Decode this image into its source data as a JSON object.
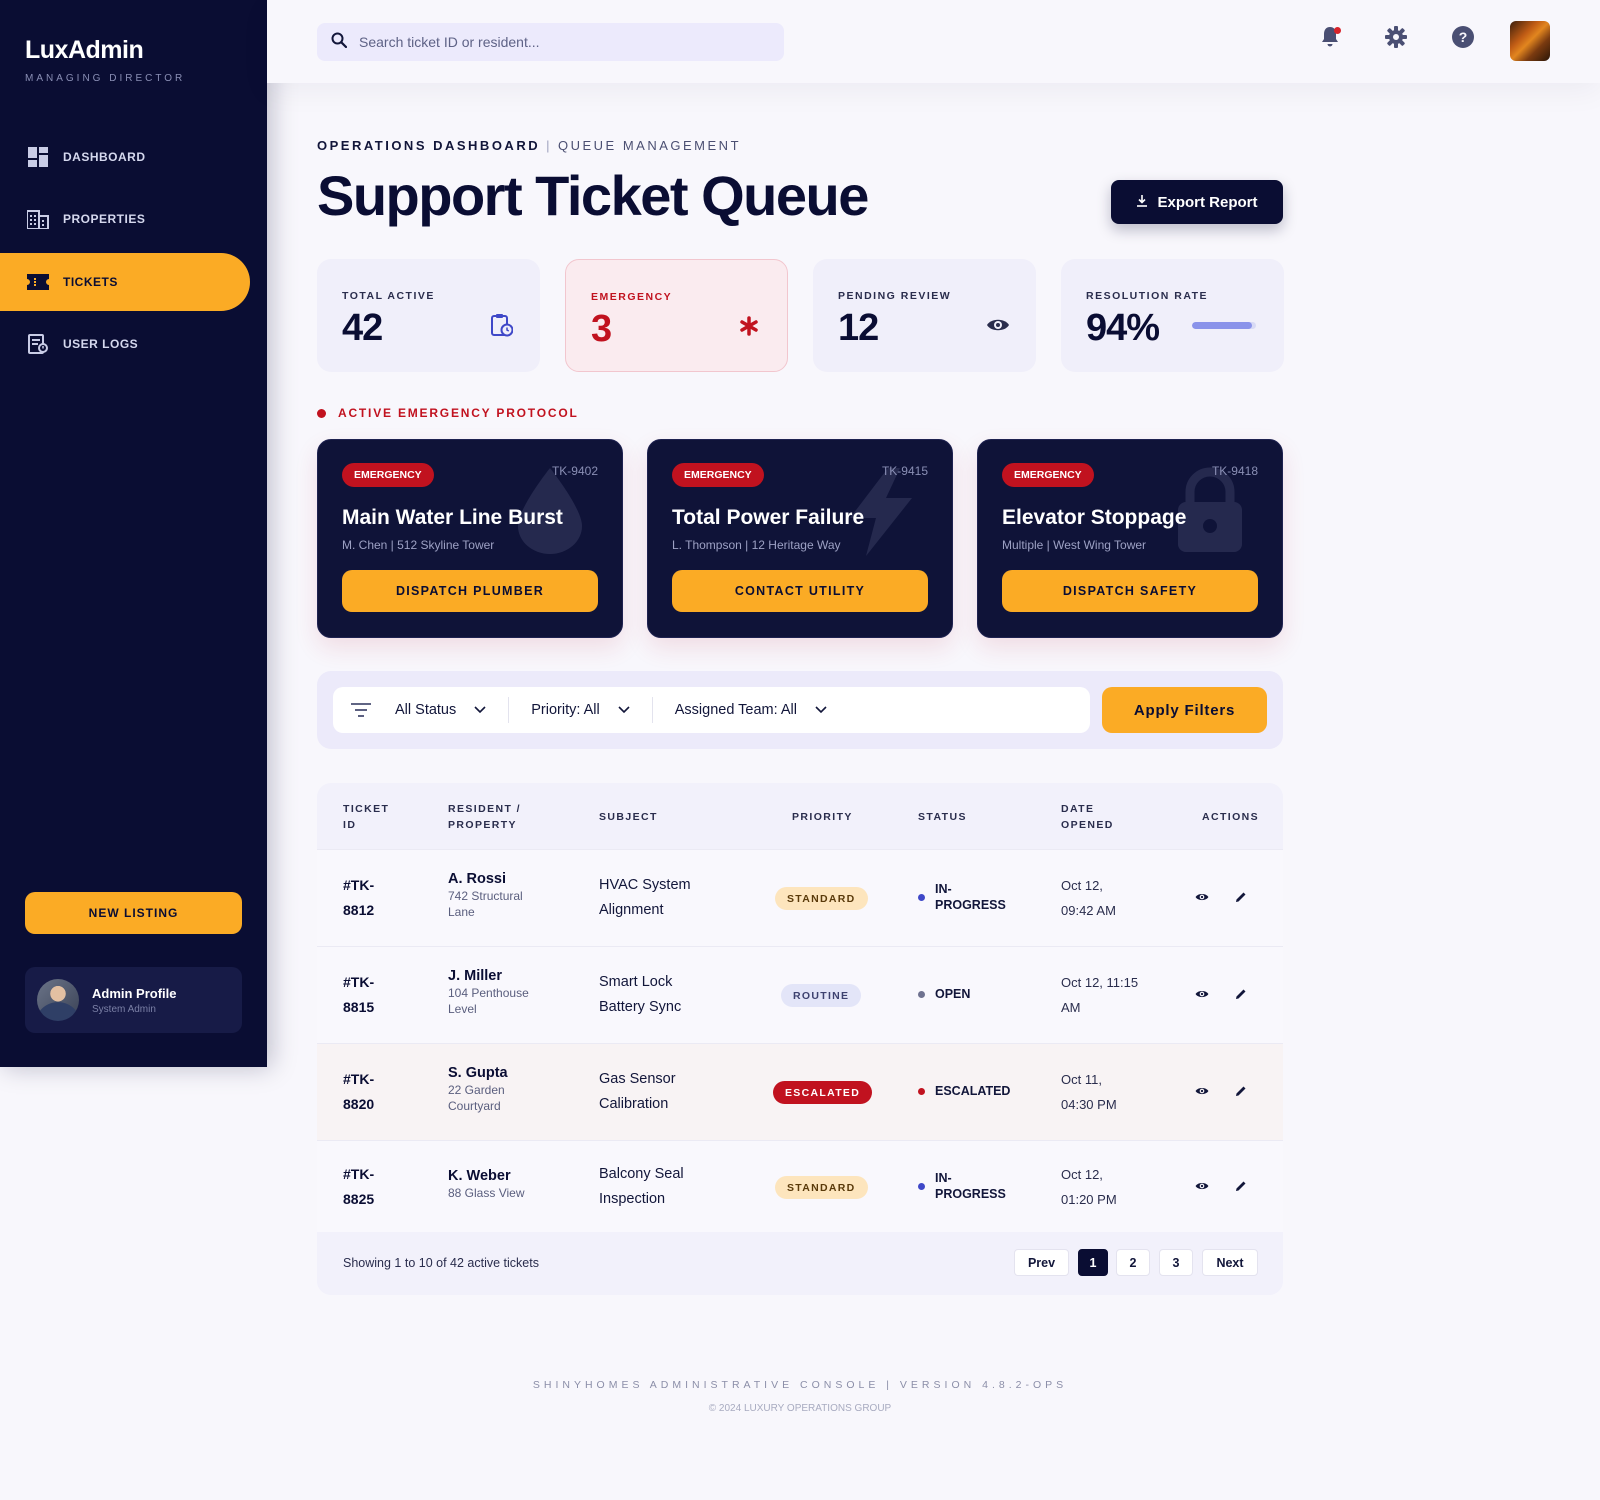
{
  "brand": {
    "name": "LuxAdmin",
    "subtitle": "MANAGING DIRECTOR"
  },
  "sidebar": {
    "items": [
      {
        "label": "DASHBOARD",
        "icon": "dashboard-icon"
      },
      {
        "label": "PROPERTIES",
        "icon": "building-icon"
      },
      {
        "label": "TICKETS",
        "icon": "ticket-icon",
        "active": true
      },
      {
        "label": "USER LOGS",
        "icon": "user-logs-icon"
      }
    ],
    "new_listing": "NEW LISTING",
    "profile": {
      "name": "Admin Profile",
      "role": "System Admin"
    }
  },
  "topbar": {
    "search_placeholder": "Search ticket ID or resident..."
  },
  "header": {
    "crumb_primary": "OPERATIONS DASHBOARD",
    "crumb_separator": "|",
    "crumb_secondary": "QUEUE MANAGEMENT",
    "title": "Support Ticket Queue",
    "export_label": "Export Report"
  },
  "stats": [
    {
      "label": "TOTAL ACTIVE",
      "value": "42",
      "icon": "clipboard-clock-icon"
    },
    {
      "label": "EMERGENCY",
      "value": "3",
      "icon": "asterisk-icon"
    },
    {
      "label": "PENDING REVIEW",
      "value": "12",
      "icon": "eye-icon"
    },
    {
      "label": "RESOLUTION RATE",
      "value": "94%",
      "progress": 0.94
    }
  ],
  "protocol": {
    "label": "ACTIVE EMERGENCY PROTOCOL"
  },
  "emergencies": [
    {
      "badge": "EMERGENCY",
      "id": "TK-9402",
      "title": "Main Water Line Burst",
      "subtitle": "M. Chen | 512 Skyline Tower",
      "action": "DISPATCH PLUMBER",
      "icon": "water-drop-icon"
    },
    {
      "badge": "EMERGENCY",
      "id": "TK-9415",
      "title": "Total Power Failure",
      "subtitle": "L. Thompson | 12 Heritage Way",
      "action": "CONTACT UTILITY",
      "icon": "lightning-icon"
    },
    {
      "badge": "EMERGENCY",
      "id": "TK-9418",
      "title": "Elevator Stoppage",
      "subtitle": "Multiple | West Wing Tower",
      "action": "DISPATCH SAFETY",
      "icon": "lock-icon"
    }
  ],
  "filters": {
    "status": "All Status",
    "priority": "Priority: All",
    "team": "Assigned Team: All",
    "apply": "Apply Filters"
  },
  "table": {
    "headers": {
      "id_1": "TICKET",
      "id_2": "ID",
      "res_1": "RESIDENT /",
      "res_2": "PROPERTY",
      "subject": "SUBJECT",
      "priority": "PRIORITY",
      "status": "STATUS",
      "date_1": "DATE",
      "date_2": "OPENED",
      "actions": "ACTIONS"
    },
    "rows": [
      {
        "id_1": "#TK-",
        "id_2": "8812",
        "name": "A. Rossi",
        "prop_1": "742 Structural",
        "prop_2": "Lane",
        "subj_1": "HVAC System",
        "subj_2": "Alignment",
        "priority": "STANDARD",
        "status_1": "IN-",
        "status_2": "PROGRESS",
        "date_1": "Oct 12,",
        "date_2": "09:42 AM"
      },
      {
        "id_1": "#TK-",
        "id_2": "8815",
        "name": "J. Miller",
        "prop_1": "104 Penthouse",
        "prop_2": "Level",
        "subj_1": "Smart Lock",
        "subj_2": "Battery Sync",
        "priority": "ROUTINE",
        "status_1": "OPEN",
        "status_2": "",
        "date_1": "Oct 12, 11:15",
        "date_2": "AM"
      },
      {
        "id_1": "#TK-",
        "id_2": "8820",
        "name": "S. Gupta",
        "prop_1": "22 Garden",
        "prop_2": "Courtyard",
        "subj_1": "Gas Sensor",
        "subj_2": "Calibration",
        "priority": "ESCALATED",
        "status_1": "ESCALATED",
        "status_2": "",
        "date_1": "Oct 11,",
        "date_2": "04:30 PM"
      },
      {
        "id_1": "#TK-",
        "id_2": "8825",
        "name": "K. Weber",
        "prop_1": "88 Glass View",
        "prop_2": "",
        "subj_1": "Balcony Seal",
        "subj_2": "Inspection",
        "priority": "STANDARD",
        "status_1": "IN-",
        "status_2": "PROGRESS",
        "date_1": "Oct 12,",
        "date_2": "01:20 PM"
      }
    ],
    "showing": "Showing 1 to 10 of 42 active tickets",
    "pagination": {
      "prev": "Prev",
      "p1": "1",
      "p2": "2",
      "p3": "3",
      "next": "Next"
    }
  },
  "footer": {
    "line1": "SHINYHOMES ADMINISTRATIVE CONSOLE | VERSION 4.8.2-OPS",
    "line2": "© 2024 LUXURY OPERATIONS GROUP"
  },
  "colors": {
    "navy": "#0a0d33",
    "accent": "#fbab25",
    "danger": "#c1121f",
    "progress": "#3f48c8",
    "muted": "#6f7290"
  }
}
